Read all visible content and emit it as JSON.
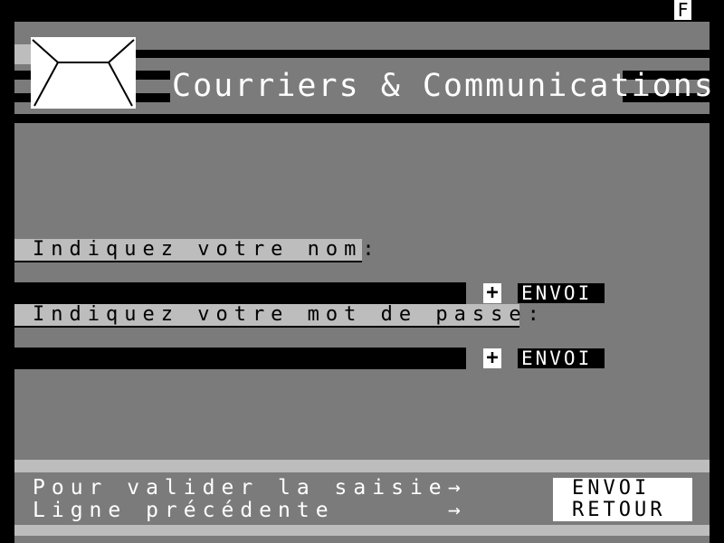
{
  "page_indicator": "F",
  "header": {
    "title": "Courriers & Communications",
    "icon": "envelope-icon"
  },
  "form": {
    "name": {
      "label": "Indiquez votre nom:",
      "prompt": "→",
      "value": "........................",
      "plus": "+",
      "send": "ENVOI"
    },
    "password": {
      "label": "Indiquez votre mot de passe:",
      "prompt": "→",
      "value": "........................",
      "plus": "+",
      "send": "ENVOI"
    }
  },
  "footer": {
    "line1": "Pour valider la saisie",
    "arrow1": "→",
    "line2": "Ligne précédente",
    "arrow2": "→",
    "key1": "ENVOI",
    "key2": "RETOUR"
  },
  "colors": {
    "background": "#7b7b7b",
    "light": "#bdbdbd",
    "black": "#000000",
    "white": "#ffffff"
  }
}
